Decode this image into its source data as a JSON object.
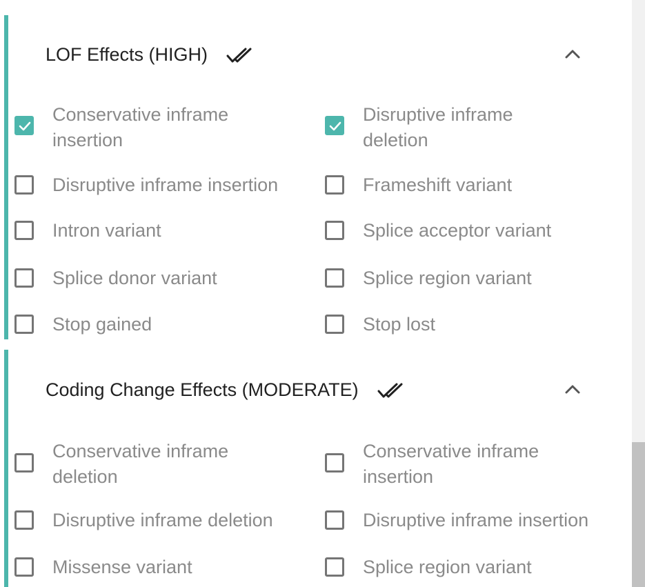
{
  "sections": [
    {
      "title": "LOF Effects (HIGH)",
      "options": [
        {
          "label": "Conservative inframe insertion",
          "checked": true
        },
        {
          "label": "Disruptive inframe deletion",
          "checked": true
        },
        {
          "label": "Disruptive inframe insertion",
          "checked": false
        },
        {
          "label": "Frameshift variant",
          "checked": false
        },
        {
          "label": "Intron variant",
          "checked": false
        },
        {
          "label": "Splice acceptor variant",
          "checked": false
        },
        {
          "label": "Splice donor variant",
          "checked": false
        },
        {
          "label": "Splice region variant",
          "checked": false
        },
        {
          "label": "Stop gained",
          "checked": false
        },
        {
          "label": "Stop lost",
          "checked": false
        }
      ]
    },
    {
      "title": "Coding Change Effects (MODERATE)",
      "options": [
        {
          "label": "Conservative inframe deletion",
          "checked": false
        },
        {
          "label": "Conservative inframe insertion",
          "checked": false
        },
        {
          "label": "Disruptive inframe deletion",
          "checked": false
        },
        {
          "label": "Disruptive inframe insertion",
          "checked": false
        },
        {
          "label": "Missense variant",
          "checked": false
        },
        {
          "label": "Splice region variant",
          "checked": false
        }
      ]
    }
  ],
  "icons": {
    "select_all": "double-check-icon",
    "collapse": "chevron-up-icon"
  },
  "colors": {
    "accent": "#4db6ac",
    "label": "#8a8a8a",
    "title": "#212121"
  }
}
